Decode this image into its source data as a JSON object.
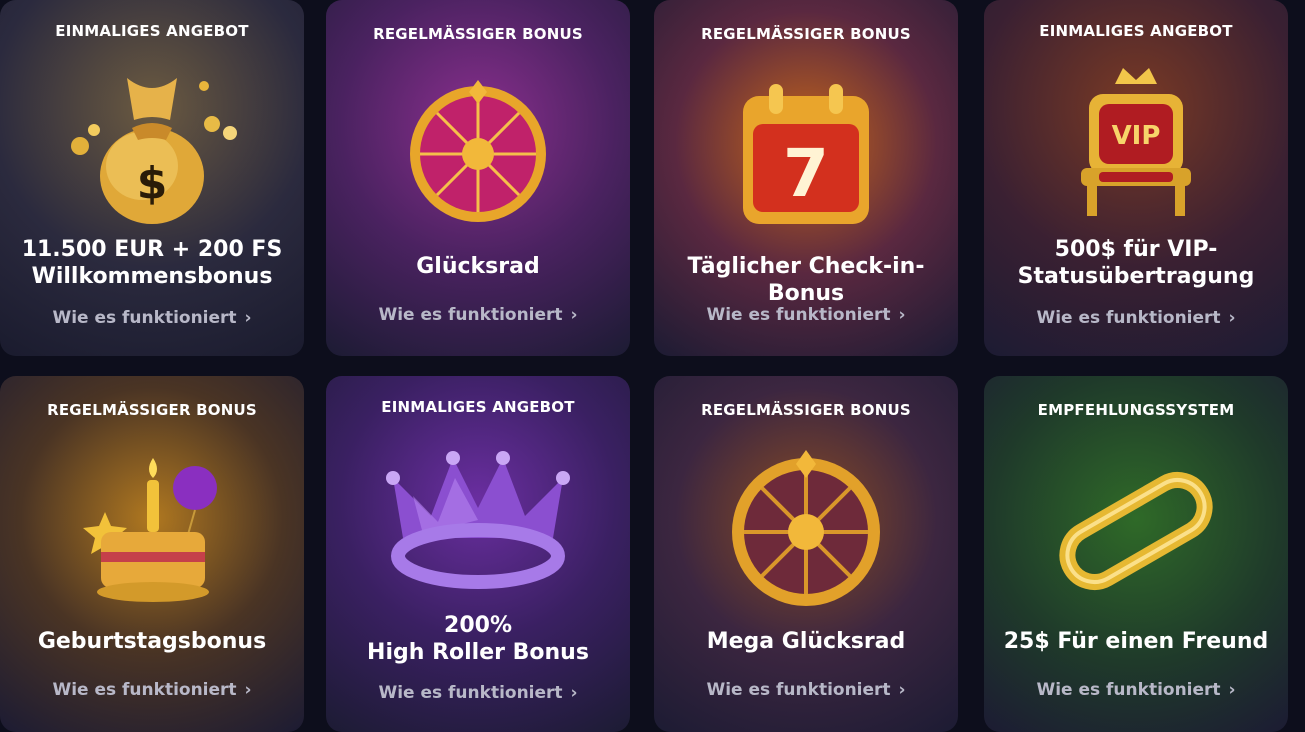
{
  "cards": [
    {
      "tag": "EINMALIGES ANGEBOT",
      "title": "11.500 EUR + 200 FS Willkommensbonus",
      "link": "Wie es funktioniert",
      "icon": "money-bag-icon"
    },
    {
      "tag": "REGELMÄSSIGER BONUS",
      "title": "Glücksrad",
      "link": "Wie es funktioniert",
      "icon": "fortune-wheel-icon"
    },
    {
      "tag": "REGELMÄSSIGER BONUS",
      "title": "Täglicher Check-in-Bonus",
      "link": "Wie es funktioniert",
      "icon": "calendar-icon",
      "calendar_day": "7"
    },
    {
      "tag": "EINMALIGES ANGEBOT",
      "title": "500$ für VIP-Statusübertragung",
      "link": "Wie es funktioniert",
      "icon": "vip-throne-icon",
      "vip_label": "VIP"
    },
    {
      "tag": "REGELMÄSSIGER BONUS",
      "title": "Geburtstagsbonus",
      "link": "Wie es funktioniert",
      "icon": "birthday-cake-icon"
    },
    {
      "tag": "EINMALIGES ANGEBOT",
      "title": "200% High Roller Bonus",
      "link": "Wie es funktioniert",
      "icon": "crown-icon"
    },
    {
      "tag": "REGELMÄSSIGER BONUS",
      "title": "Mega Glücksrad",
      "link": "Wie es funktioniert",
      "icon": "mega-wheel-icon"
    },
    {
      "tag": "EMPFEHLUNGSSYSTEM",
      "title": "25$ Für einen Freund",
      "link": "Wie es funktioniert",
      "icon": "chain-link-icon"
    }
  ],
  "title_lines": {
    "c0": [
      "11.500 EUR + 200 FS",
      "Willkommensbonus"
    ],
    "c3": [
      "500$ für VIP-",
      "Statusübertragung"
    ],
    "c5": [
      "200%",
      "High Roller Bonus"
    ]
  }
}
